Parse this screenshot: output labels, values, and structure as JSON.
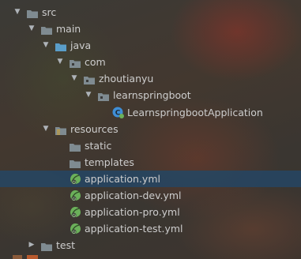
{
  "tree": [
    {
      "label": "src",
      "arrow": "expanded",
      "icon": "folder-icon"
    },
    {
      "label": "main",
      "arrow": "expanded",
      "icon": "folder-icon"
    },
    {
      "label": "java",
      "arrow": "expanded",
      "icon": "source-folder-icon"
    },
    {
      "label": "com",
      "arrow": "expanded",
      "icon": "package-icon"
    },
    {
      "label": "zhoutianyu",
      "arrow": "expanded",
      "icon": "package-icon"
    },
    {
      "label": "learnspringboot",
      "arrow": "expanded",
      "icon": "package-icon"
    },
    {
      "label": "LearnspringbootApplication",
      "arrow": "none",
      "icon": "spring-boot-class-icon"
    },
    {
      "label": "resources",
      "arrow": "expanded",
      "icon": "resources-folder-icon"
    },
    {
      "label": "static",
      "arrow": "none",
      "icon": "folder-icon"
    },
    {
      "label": "templates",
      "arrow": "none",
      "icon": "folder-icon"
    },
    {
      "label": "application.yml",
      "arrow": "none",
      "icon": "spring-config-file-icon",
      "selected": true
    },
    {
      "label": "application-dev.yml",
      "arrow": "none",
      "icon": "spring-config-file-icon"
    },
    {
      "label": "application-pro.yml",
      "arrow": "none",
      "icon": "spring-config-file-icon"
    },
    {
      "label": "application-test.yml",
      "arrow": "none",
      "icon": "spring-config-file-icon"
    },
    {
      "label": "test",
      "arrow": "collapsed",
      "icon": "folder-icon"
    }
  ],
  "colors": {
    "selection": "#264662",
    "folder": "#7f8b91",
    "source_folder": "#5a9ec9",
    "resources_marker": "#c9a13a",
    "spring_green": "#6bb05a",
    "class_blue": "#3f8ed6",
    "text": "#cdcdcd"
  }
}
